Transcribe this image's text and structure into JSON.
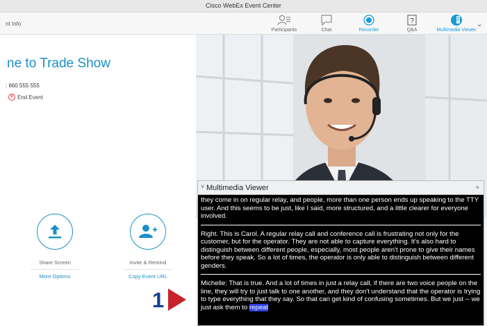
{
  "window": {
    "title": "Cisco WebEx Event Center"
  },
  "toolbar": {
    "event_info_tab": "nt Info",
    "items": [
      {
        "label": "Participants",
        "icon": "participants-icon"
      },
      {
        "label": "Chat",
        "icon": "chat-icon"
      },
      {
        "label": "Recorder",
        "icon": "recorder-icon"
      },
      {
        "label": "Q&A",
        "icon": "qa-icon"
      },
      {
        "label": "Multimedia Viewer",
        "icon": "multimedia-viewer-icon"
      }
    ],
    "active_color": "#1a9bd7"
  },
  "event": {
    "title": "ne to Trade Show",
    "number": ": 660 555 555",
    "end_event_label": "End Event"
  },
  "actions": {
    "share_screen": {
      "label": "Share Screen",
      "link": "More Options"
    },
    "invite": {
      "label": "Invite & Remind",
      "link": "Copy Event URL"
    }
  },
  "marker": {
    "number": "1"
  },
  "multimedia_viewer": {
    "title": "Multimedia Viewer",
    "close": "×",
    "paragraphs": [
      "they come in on regular relay, and people, more than one person ends up speaking to the TTY user. And this seems to be just, like I said, more structured, and a little clearer for everyone involved.",
      "Right. This is Carol. A regular relay call and conference call is frustrating not only for the customer, but for the operator. They are not able to capture everything. It's also hard to distinguish between different people, especially, most people aren't prone to give their names before they speak. So a lot of times, the operator is only able to distinguish between different genders.",
      "Michelle: That is true. And a lot of times in just a relay call, if there are two voice people on the line, they will try to just talk to one another, and they don't understand that the operator is trying to type everything that they say. So that can get kind of confusing sometimes. But we just -- we just ask them to"
    ],
    "highlight_word": "repeat",
    "highlight_color": "#2f3fe0"
  }
}
